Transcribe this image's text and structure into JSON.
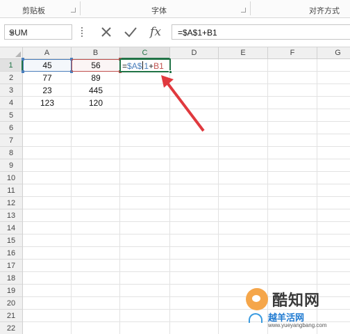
{
  "ribbon": {
    "groups": [
      {
        "label": "剪贴板"
      },
      {
        "label": "字体"
      },
      {
        "label": "对齐方式"
      }
    ]
  },
  "formula_bar": {
    "name_box": "SUM",
    "cancel_icon": "x-icon",
    "enter_icon": "check-icon",
    "fx_label": "fx",
    "formula": "=$A$1+B1"
  },
  "sheet": {
    "columns": [
      "A",
      "B",
      "C",
      "D",
      "E",
      "F",
      "G"
    ],
    "rows": [
      "1",
      "2",
      "3",
      "4",
      "5",
      "6",
      "7",
      "8",
      "9",
      "10",
      "11",
      "12",
      "13",
      "14",
      "15",
      "16",
      "17",
      "18",
      "19",
      "20",
      "21",
      "22"
    ],
    "active_column": "C",
    "active_row": "1",
    "cells": {
      "A1": "45",
      "B1": "56",
      "A2": "77",
      "B2": "89",
      "A3": "23",
      "B3": "445",
      "A4": "123",
      "B4": "120"
    },
    "edit_cell": {
      "eq": "=",
      "ref_a": "$A$",
      "ref_a_tail": "1",
      "plus": "+",
      "ref_b": "B1"
    }
  },
  "colors": {
    "accent": "#217346",
    "ref_a": "#4a7ebb",
    "ref_b": "#c0504d",
    "arrow": "#e0393e"
  },
  "watermark": {
    "brand": "酷知网",
    "sub": "越羊活网",
    "url": "www.yueyangbang.com"
  }
}
